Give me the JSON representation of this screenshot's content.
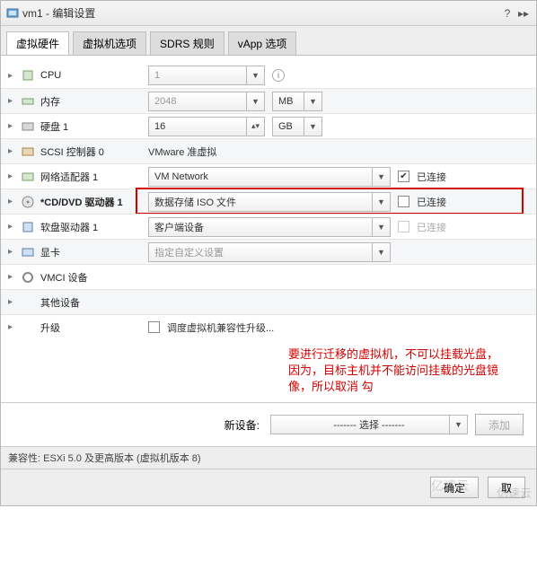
{
  "title": "vm1 - 编辑设置",
  "tabs": [
    "虚拟硬件",
    "虚拟机选项",
    "SDRS 规则",
    "vApp 选项"
  ],
  "active_tab_index": 0,
  "rows": {
    "cpu": {
      "label": "CPU",
      "value": "1"
    },
    "memory": {
      "label": "内存",
      "value": "2048",
      "unit": "MB"
    },
    "disk": {
      "label": "硬盘 1",
      "value": "16",
      "unit": "GB"
    },
    "scsi": {
      "label": "SCSI 控制器 0",
      "value": "VMware 准虚拟"
    },
    "net": {
      "label": "网络适配器 1",
      "value": "VM Network",
      "connected": true,
      "conn_label": "已连接"
    },
    "cd": {
      "label": "*CD/DVD 驱动器 1",
      "value": "数据存储 ISO 文件",
      "connected": false,
      "conn_label": "已连接"
    },
    "floppy": {
      "label": "软盘驱动器 1",
      "value": "客户端设备",
      "connected": false,
      "conn_label": "已连接"
    },
    "video": {
      "label": "显卡",
      "value": "指定自定义设置"
    },
    "vmci": {
      "label": "VMCI 设备"
    },
    "other": {
      "label": "其他设备"
    },
    "upgrade": {
      "label": "升级",
      "checkbox_label": "调度虚拟机兼容性升级..."
    }
  },
  "annotation": "要进行迁移的虚拟机，不可以挂载光盘，因为，目标主机并不能访问挂载的光盘镜像，所以取消 勾",
  "new_device": {
    "label": "新设备:",
    "select": "------- 选择 -------",
    "add": "添加"
  },
  "compat": "兼容性: ESXi 5.0 及更高版本 (虚拟机版本 8)",
  "buttons": {
    "ok": "确定",
    "cancel": "取"
  },
  "watermark": "亿速云"
}
